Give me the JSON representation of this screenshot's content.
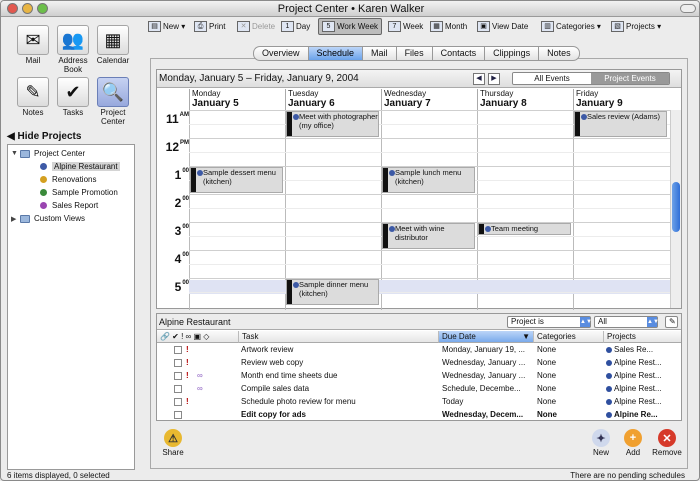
{
  "window": {
    "title": "Project Center • Karen Walker"
  },
  "modules": [
    {
      "label": "Mail",
      "icon": "mail-icon",
      "glyph": "✉"
    },
    {
      "label": "Address Book",
      "icon": "address-book-icon",
      "glyph": "👥"
    },
    {
      "label": "Calendar",
      "icon": "calendar-icon",
      "glyph": "▦"
    },
    {
      "label": "Notes",
      "icon": "notes-icon",
      "glyph": "✎"
    },
    {
      "label": "Tasks",
      "icon": "tasks-icon",
      "glyph": "✔"
    },
    {
      "label": "Project Center",
      "icon": "project-center-icon",
      "glyph": "🔍"
    }
  ],
  "sidebar": {
    "hide_projects": "Hide Projects",
    "tree": [
      {
        "label": "Project Center",
        "level": 0
      },
      {
        "label": "Alpine Restaurant",
        "level": 1,
        "color": "#3d5aa6",
        "selected": true
      },
      {
        "label": "Renovations",
        "level": 1,
        "color": "#d4a020"
      },
      {
        "label": "Sample Promotion",
        "level": 1,
        "color": "#3a8a3a"
      },
      {
        "label": "Sales Report",
        "level": 1,
        "color": "#9a45b0"
      },
      {
        "label": "Custom Views",
        "level": 0
      }
    ]
  },
  "toolbar": {
    "new": "New",
    "print": "Print",
    "delete": "Delete",
    "day": "Day",
    "work_week": "Work Week",
    "week": "Week",
    "month": "Month",
    "view_date": "View Date",
    "categories": "Categories",
    "projects": "Projects"
  },
  "tabs": [
    "Overview",
    "Schedule",
    "Mail",
    "Files",
    "Contacts",
    "Clippings",
    "Notes"
  ],
  "calendar": {
    "range": "Monday, January 5 – Friday, January 9, 2004",
    "all_events": "All Events",
    "project_events": "Project Events",
    "days": [
      {
        "name": "Monday",
        "date": "January 5"
      },
      {
        "name": "Tuesday",
        "date": "January 6"
      },
      {
        "name": "Wednesday",
        "date": "January 7"
      },
      {
        "name": "Thursday",
        "date": "January 8"
      },
      {
        "name": "Friday",
        "date": "January 9"
      }
    ],
    "hours": [
      {
        "h": "11",
        "s": "AM"
      },
      {
        "h": "12",
        "s": "PM"
      },
      {
        "h": "1",
        "s": "00"
      },
      {
        "h": "2",
        "s": "00"
      },
      {
        "h": "3",
        "s": "00"
      },
      {
        "h": "4",
        "s": "00"
      },
      {
        "h": "5",
        "s": "00"
      }
    ],
    "events": [
      {
        "text": "Meet with photographer (my office)",
        "day": 1,
        "start": 11,
        "dur": 1
      },
      {
        "text": "Sales review (Adams)",
        "day": 4,
        "start": 11,
        "dur": 1
      },
      {
        "text": "Sample dessert menu (kitchen)",
        "day": 0,
        "start": 13,
        "dur": 1
      },
      {
        "text": "Sample lunch menu (kitchen)",
        "day": 2,
        "start": 13,
        "dur": 1
      },
      {
        "text": "Meet with wine distributor",
        "day": 2,
        "start": 15,
        "dur": 1
      },
      {
        "text": "Team meeting",
        "day": 3,
        "start": 15,
        "dur": 0.5
      },
      {
        "text": "Sample dinner menu (kitchen)",
        "day": 1,
        "start": 17,
        "dur": 1
      }
    ]
  },
  "tasks": {
    "title": "Alpine Restaurant",
    "filter1": "Project is",
    "filter2": "All",
    "columns": {
      "task": "Task",
      "due": "Due Date",
      "categories": "Categories",
      "projects": "Projects"
    },
    "rows": [
      {
        "task": "Artwork review",
        "due": "Monday, January 19, ...",
        "cat": "None",
        "proj": "Sales Re...",
        "prio": "!",
        "link": "",
        "bold": false
      },
      {
        "task": "Review web copy",
        "due": "Wednesday, January ...",
        "cat": "None",
        "proj": "Alpine Rest...",
        "prio": "!",
        "link": "",
        "bold": false
      },
      {
        "task": "Month end time sheets due",
        "due": "Wednesday, January ...",
        "cat": "None",
        "proj": "Alpine Rest...",
        "prio": "!",
        "link": "∞",
        "bold": false
      },
      {
        "task": "Compile sales data",
        "due": "Schedule, Decembe...",
        "cat": "None",
        "proj": "Alpine Rest...",
        "prio": "",
        "link": "∞",
        "bold": false
      },
      {
        "task": "Schedule photo review for menu",
        "due": "Today",
        "cat": "None",
        "proj": "Alpine Rest...",
        "prio": "!",
        "link": "",
        "bold": false
      },
      {
        "task": "Edit copy for ads",
        "due": "Wednesday, Decem...",
        "cat": "None",
        "proj": "Alpine Re...",
        "prio": "",
        "link": "",
        "bold": true
      }
    ]
  },
  "bottom": {
    "share": "Share",
    "new": "New",
    "add": "Add",
    "remove": "Remove"
  },
  "status": {
    "left": "6 items displayed, 0 selected",
    "right": "There are no pending schedules"
  }
}
